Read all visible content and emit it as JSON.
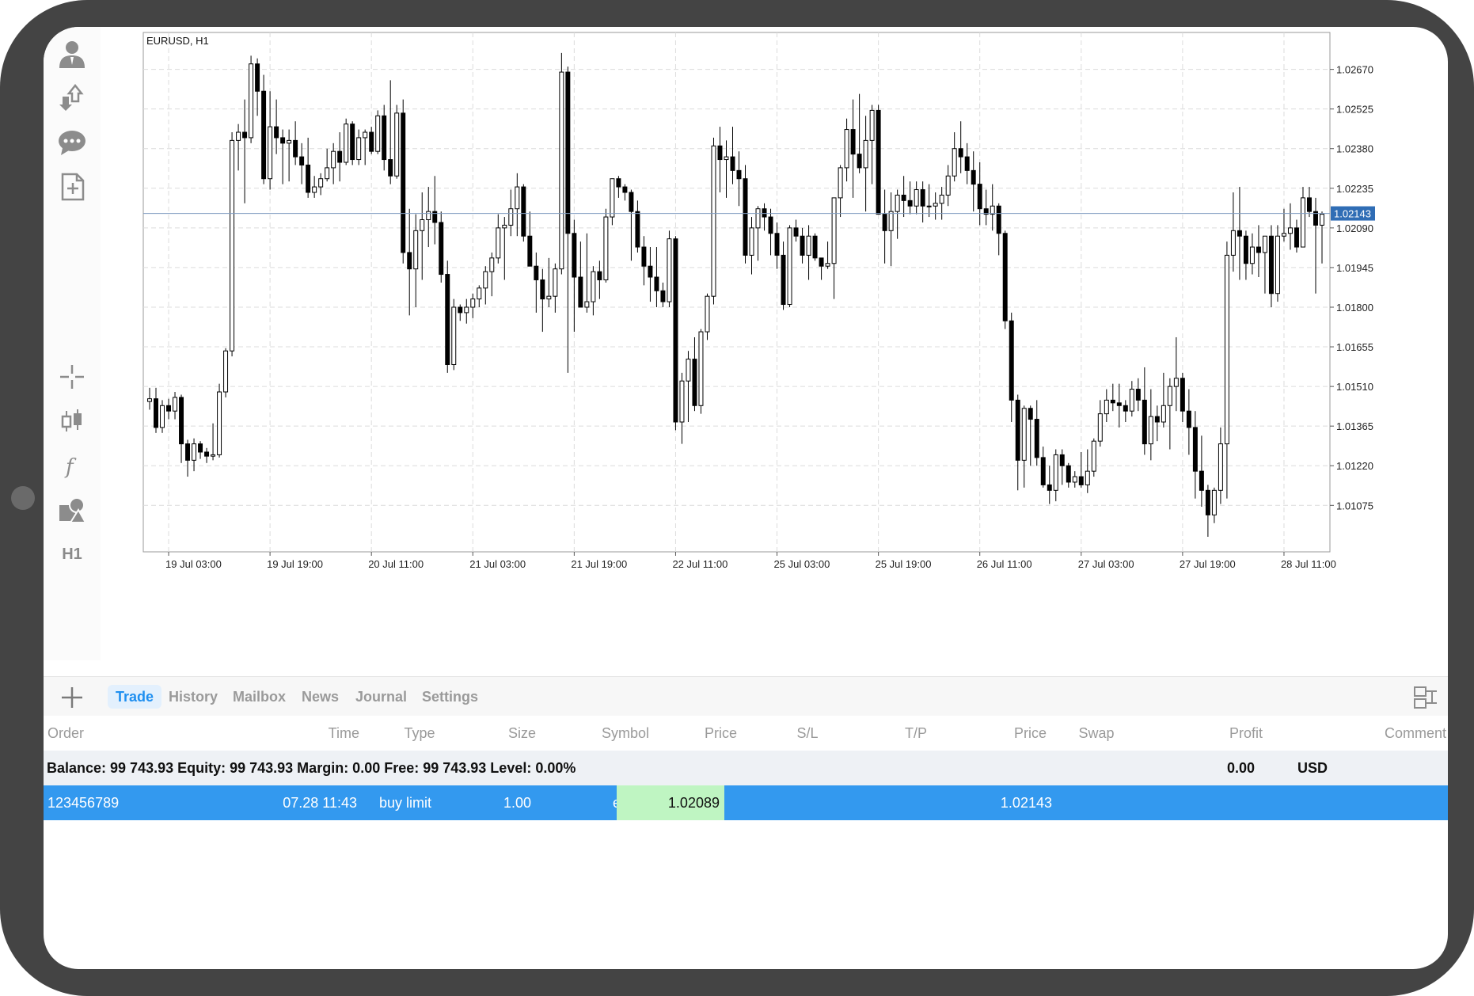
{
  "chart": {
    "symbol_label": "EURUSD, H1",
    "current_price_label": "1.02143"
  },
  "chart_data": {
    "type": "candlestick",
    "title": "EURUSD, H1",
    "timeframe": "H1",
    "ylim": [
      1.00905,
      1.02805
    ],
    "y_ticks": [
      "1.02670",
      "1.02525",
      "1.02380",
      "1.02235",
      "1.02090",
      "1.01945",
      "1.01800",
      "1.01655",
      "1.01510",
      "1.01365",
      "1.01220",
      "1.01075"
    ],
    "x_ticks": [
      "19 Jul 03:00",
      "19 Jul 19:00",
      "20 Jul 11:00",
      "21 Jul 03:00",
      "21 Jul 19:00",
      "22 Jul 11:00",
      "25 Jul 03:00",
      "25 Jul 19:00",
      "26 Jul 11:00",
      "27 Jul 03:00",
      "27 Jul 19:00",
      "28 Jul 11:00"
    ],
    "current_price": 1.02143,
    "grid": true,
    "colors": {
      "bull": "#ffffff",
      "bear": "#000000",
      "wick": "#000000",
      "grid": "#dcdcdc",
      "price_line": "#7f9cc0",
      "price_tag": "#2f6db5"
    },
    "candles": [
      [
        1.01455,
        1.01505,
        1.01425,
        1.01465
      ],
      [
        1.01465,
        1.01505,
        1.0134,
        1.0136
      ],
      [
        1.0136,
        1.0146,
        1.0134,
        1.0144
      ],
      [
        1.0144,
        1.01465,
        1.0139,
        1.0142
      ],
      [
        1.0142,
        1.0149,
        1.0139,
        1.0147
      ],
      [
        1.0147,
        1.0148,
        1.0123,
        1.013
      ],
      [
        1.013,
        1.01315,
        1.0118,
        1.0124
      ],
      [
        1.0124,
        1.0132,
        1.012,
        1.013
      ],
      [
        1.013,
        1.0131,
        1.01245,
        1.0127
      ],
      [
        1.0127,
        1.01285,
        1.0123,
        1.01255
      ],
      [
        1.01255,
        1.01375,
        1.0124,
        1.0126
      ],
      [
        1.0126,
        1.0152,
        1.0125,
        1.0149
      ],
      [
        1.0149,
        1.0165,
        1.0147,
        1.0164
      ],
      [
        1.0164,
        1.0244,
        1.0162,
        1.0241
      ],
      [
        1.0241,
        1.0247,
        1.023,
        1.0244
      ],
      [
        1.0244,
        1.0256,
        1.0218,
        1.0242
      ],
      [
        1.0242,
        1.0272,
        1.024,
        1.0269
      ],
      [
        1.0269,
        1.0271,
        1.025,
        1.0259
      ],
      [
        1.0259,
        1.0265,
        1.0225,
        1.0227
      ],
      [
        1.0227,
        1.0259,
        1.0223,
        1.0246
      ],
      [
        1.0246,
        1.0256,
        1.0236,
        1.0242
      ],
      [
        1.0242,
        1.0245,
        1.0225,
        1.024
      ],
      [
        1.024,
        1.0245,
        1.0226,
        1.0241
      ],
      [
        1.0241,
        1.0248,
        1.0232,
        1.0235
      ],
      [
        1.0235,
        1.024,
        1.0225,
        1.0232
      ],
      [
        1.0232,
        1.0242,
        1.022,
        1.0222
      ],
      [
        1.0222,
        1.0228,
        1.022,
        1.0224
      ],
      [
        1.0224,
        1.0229,
        1.0221,
        1.0227
      ],
      [
        1.0227,
        1.0238,
        1.0226,
        1.0231
      ],
      [
        1.0231,
        1.024,
        1.0225,
        1.0237
      ],
      [
        1.0237,
        1.0244,
        1.0226,
        1.0233
      ],
      [
        1.0233,
        1.0249,
        1.0232,
        1.0247
      ],
      [
        1.0247,
        1.0248,
        1.0232,
        1.0234
      ],
      [
        1.0234,
        1.0245,
        1.0232,
        1.0242
      ],
      [
        1.0242,
        1.0245,
        1.0232,
        1.0244
      ],
      [
        1.0244,
        1.0246,
        1.0236,
        1.0237
      ],
      [
        1.0237,
        1.0252,
        1.0236,
        1.025
      ],
      [
        1.025,
        1.0254,
        1.023,
        1.0234
      ],
      [
        1.0234,
        1.0263,
        1.0225,
        1.0228
      ],
      [
        1.0228,
        1.0254,
        1.0227,
        1.0251
      ],
      [
        1.0251,
        1.0256,
        1.0196,
        1.02
      ],
      [
        1.02,
        1.0216,
        1.0177,
        1.0194
      ],
      [
        1.0194,
        1.0214,
        1.018,
        1.0208
      ],
      [
        1.0208,
        1.0222,
        1.019,
        1.0212
      ],
      [
        1.0212,
        1.0224,
        1.0202,
        1.0215
      ],
      [
        1.0215,
        1.0228,
        1.0203,
        1.0211
      ],
      [
        1.0211,
        1.0215,
        1.0189,
        1.0192
      ],
      [
        1.0192,
        1.0197,
        1.0156,
        1.0159
      ],
      [
        1.0159,
        1.0183,
        1.0157,
        1.018
      ],
      [
        1.018,
        1.0181,
        1.0175,
        1.0178
      ],
      [
        1.0178,
        1.0183,
        1.0174,
        1.018
      ],
      [
        1.018,
        1.0185,
        1.0176,
        1.0183
      ],
      [
        1.0183,
        1.0188,
        1.018,
        1.0187
      ],
      [
        1.0187,
        1.0195,
        1.0181,
        1.0193
      ],
      [
        1.0193,
        1.02,
        1.0184,
        1.0198
      ],
      [
        1.0198,
        1.0214,
        1.0196,
        1.0209
      ],
      [
        1.0209,
        1.0213,
        1.019,
        1.021
      ],
      [
        1.021,
        1.0223,
        1.0206,
        1.0216
      ],
      [
        1.0216,
        1.0229,
        1.0206,
        1.0224
      ],
      [
        1.0224,
        1.0225,
        1.0204,
        1.0206
      ],
      [
        1.0206,
        1.0215,
        1.0196,
        1.0195
      ],
      [
        1.0195,
        1.02,
        1.0178,
        1.019
      ],
      [
        1.019,
        1.0194,
        1.0171,
        1.0183
      ],
      [
        1.0183,
        1.0198,
        1.018,
        1.0184
      ],
      [
        1.0184,
        1.0196,
        1.0178,
        1.0194
      ],
      [
        1.0194,
        1.0273,
        1.0192,
        1.0266
      ],
      [
        1.0266,
        1.0268,
        1.0156,
        1.0207
      ],
      [
        1.0207,
        1.0212,
        1.0171,
        1.0191
      ],
      [
        1.0191,
        1.0204,
        1.018,
        1.018
      ],
      [
        1.018,
        1.0207,
        1.0178,
        1.0182
      ],
      [
        1.0182,
        1.0195,
        1.0177,
        1.0193
      ],
      [
        1.0193,
        1.0197,
        1.0183,
        1.019
      ],
      [
        1.019,
        1.0216,
        1.0189,
        1.0213
      ],
      [
        1.0213,
        1.0226,
        1.021,
        1.0227
      ],
      [
        1.0227,
        1.0228,
        1.022,
        1.0224
      ],
      [
        1.0224,
        1.0225,
        1.0219,
        1.0222
      ],
      [
        1.0222,
        1.0223,
        1.0197,
        1.0215
      ],
      [
        1.0215,
        1.0219,
        1.02,
        1.0202
      ],
      [
        1.0202,
        1.0206,
        1.0188,
        1.0195
      ],
      [
        1.0195,
        1.0202,
        1.0182,
        1.0191
      ],
      [
        1.0191,
        1.0202,
        1.018,
        1.0186
      ],
      [
        1.0186,
        1.0189,
        1.018,
        1.0182
      ],
      [
        1.0182,
        1.0208,
        1.018,
        1.0205
      ],
      [
        1.0205,
        1.0206,
        1.0135,
        1.0138
      ],
      [
        1.0138,
        1.0156,
        1.013,
        1.0153
      ],
      [
        1.0153,
        1.0164,
        1.0138,
        1.0161
      ],
      [
        1.0161,
        1.0169,
        1.0142,
        1.0144
      ],
      [
        1.0144,
        1.0172,
        1.0141,
        1.0171
      ],
      [
        1.0171,
        1.0185,
        1.0168,
        1.0184
      ],
      [
        1.0184,
        1.0242,
        1.0181,
        1.0239
      ],
      [
        1.0239,
        1.0246,
        1.0222,
        1.0234
      ],
      [
        1.0234,
        1.0241,
        1.022,
        1.0235
      ],
      [
        1.0235,
        1.0246,
        1.0225,
        1.023
      ],
      [
        1.023,
        1.0237,
        1.0217,
        1.0227
      ],
      [
        1.0227,
        1.0232,
        1.0196,
        1.0199
      ],
      [
        1.0199,
        1.0213,
        1.0192,
        1.0209
      ],
      [
        1.0209,
        1.0217,
        1.0197,
        1.0216
      ],
      [
        1.0216,
        1.0218,
        1.0208,
        1.0213
      ],
      [
        1.0213,
        1.0216,
        1.0199,
        1.0207
      ],
      [
        1.0207,
        1.0211,
        1.0194,
        1.0199
      ],
      [
        1.0199,
        1.0204,
        1.0179,
        1.0181
      ],
      [
        1.0181,
        1.021,
        1.018,
        1.0209
      ],
      [
        1.0209,
        1.0212,
        1.0204,
        1.0206
      ],
      [
        1.0206,
        1.0209,
        1.0196,
        1.0199
      ],
      [
        1.0199,
        1.021,
        1.019,
        1.0206
      ],
      [
        1.0206,
        1.0207,
        1.0197,
        1.0198
      ],
      [
        1.0198,
        1.0196,
        1.019,
        1.0195
      ],
      [
        1.0195,
        1.0204,
        1.0194,
        1.0196
      ],
      [
        1.0196,
        1.0215,
        1.0183,
        1.022
      ],
      [
        1.022,
        1.0232,
        1.0213,
        1.0231
      ],
      [
        1.0231,
        1.0249,
        1.0226,
        1.0245
      ],
      [
        1.0245,
        1.0256,
        1.022,
        1.0236
      ],
      [
        1.0236,
        1.0258,
        1.0229,
        1.0231
      ],
      [
        1.0231,
        1.025,
        1.0215,
        1.0241
      ],
      [
        1.0241,
        1.0254,
        1.0225,
        1.0252
      ],
      [
        1.0252,
        1.0254,
        1.0215,
        1.0214
      ],
      [
        1.0214,
        1.0223,
        1.0196,
        1.0208
      ],
      [
        1.0208,
        1.0222,
        1.0195,
        1.0215
      ],
      [
        1.0215,
        1.0223,
        1.0205,
        1.0221
      ],
      [
        1.0221,
        1.0228,
        1.0213,
        1.0219
      ],
      [
        1.0219,
        1.0226,
        1.0214,
        1.0217
      ],
      [
        1.0217,
        1.0226,
        1.0214,
        1.0223
      ],
      [
        1.0223,
        1.0226,
        1.0211,
        1.0217
      ],
      [
        1.0217,
        1.0225,
        1.0213,
        1.0217
      ],
      [
        1.0217,
        1.0222,
        1.0212,
        1.0218
      ],
      [
        1.0218,
        1.0224,
        1.0212,
        1.0221
      ],
      [
        1.0221,
        1.0232,
        1.0217,
        1.0228
      ],
      [
        1.0228,
        1.0244,
        1.0226,
        1.0238
      ],
      [
        1.0238,
        1.0248,
        1.0229,
        1.0235
      ],
      [
        1.0235,
        1.024,
        1.0225,
        1.023
      ],
      [
        1.023,
        1.0237,
        1.0215,
        1.0225
      ],
      [
        1.0225,
        1.0233,
        1.021,
        1.0216
      ],
      [
        1.0216,
        1.0223,
        1.021,
        1.0214
      ],
      [
        1.0214,
        1.0225,
        1.0208,
        1.0217
      ],
      [
        1.0217,
        1.0218,
        1.0199,
        1.0207
      ],
      [
        1.0207,
        1.0208,
        1.0172,
        1.0175
      ],
      [
        1.0175,
        1.0178,
        1.0138,
        1.0146
      ],
      [
        1.0146,
        1.0148,
        1.0113,
        1.0124
      ],
      [
        1.0124,
        1.0144,
        1.0114,
        1.0143
      ],
      [
        1.0143,
        1.0144,
        1.0122,
        1.0139
      ],
      [
        1.0139,
        1.0146,
        1.0122,
        1.0125
      ],
      [
        1.0125,
        1.0129,
        1.0114,
        1.0115
      ],
      [
        1.0115,
        1.0122,
        1.0108,
        1.0113
      ],
      [
        1.0113,
        1.0128,
        1.0109,
        1.0126
      ],
      [
        1.0126,
        1.0128,
        1.0115,
        1.0122
      ],
      [
        1.0122,
        1.0123,
        1.0114,
        1.0116
      ],
      [
        1.0116,
        1.012,
        1.0114,
        1.0118
      ],
      [
        1.0118,
        1.0127,
        1.0114,
        1.0115
      ],
      [
        1.0115,
        1.0128,
        1.0112,
        1.012
      ],
      [
        1.012,
        1.0132,
        1.0118,
        1.0131
      ],
      [
        1.0131,
        1.0146,
        1.0129,
        1.0141
      ],
      [
        1.0141,
        1.015,
        1.0138,
        1.0146
      ],
      [
        1.0146,
        1.0152,
        1.0142,
        1.0145
      ],
      [
        1.0145,
        1.0152,
        1.0136,
        1.0144
      ],
      [
        1.0144,
        1.0146,
        1.0138,
        1.0142
      ],
      [
        1.0142,
        1.0153,
        1.014,
        1.015
      ],
      [
        1.015,
        1.0154,
        1.0142,
        1.0146
      ],
      [
        1.0146,
        1.0158,
        1.0126,
        1.013
      ],
      [
        1.013,
        1.015,
        1.0124,
        1.014
      ],
      [
        1.014,
        1.0144,
        1.0131,
        1.0138
      ],
      [
        1.0138,
        1.0156,
        1.0136,
        1.0144
      ],
      [
        1.0144,
        1.0154,
        1.0128,
        1.0151
      ],
      [
        1.0151,
        1.0169,
        1.0142,
        1.0154
      ],
      [
        1.0154,
        1.0156,
        1.0138,
        1.0142
      ],
      [
        1.0142,
        1.015,
        1.0126,
        1.0136
      ],
      [
        1.0136,
        1.0142,
        1.011,
        1.012
      ],
      [
        1.012,
        1.0133,
        1.0107,
        1.0113
      ],
      [
        1.0113,
        1.0115,
        1.0096,
        1.0104
      ],
      [
        1.0104,
        1.0114,
        1.0101,
        1.0113
      ],
      [
        1.0113,
        1.0136,
        1.0108,
        1.013
      ],
      [
        1.013,
        1.0204,
        1.011,
        1.0199
      ],
      [
        1.0199,
        1.0222,
        1.0193,
        1.0208
      ],
      [
        1.0208,
        1.0224,
        1.019,
        1.0206
      ],
      [
        1.0206,
        1.0208,
        1.019,
        1.0196
      ],
      [
        1.0196,
        1.0207,
        1.0192,
        1.0202
      ],
      [
        1.0202,
        1.021,
        1.0191,
        1.02
      ],
      [
        1.02,
        1.0203,
        1.0185,
        1.0206
      ],
      [
        1.0206,
        1.021,
        1.018,
        1.0185
      ],
      [
        1.0185,
        1.021,
        1.0182,
        1.0206
      ],
      [
        1.0206,
        1.0216,
        1.0204,
        1.0207
      ],
      [
        1.0207,
        1.0218,
        1.0201,
        1.0209
      ],
      [
        1.0209,
        1.0212,
        1.02,
        1.0202
      ],
      [
        1.0202,
        1.0224,
        1.0202,
        1.022
      ],
      [
        1.022,
        1.0224,
        1.0213,
        1.0215
      ],
      [
        1.0215,
        1.022,
        1.0185,
        1.021
      ],
      [
        1.021,
        1.0215,
        1.0196,
        1.0214
      ]
    ]
  },
  "toolbar": {
    "items": [
      "account-icon",
      "trade-transfer-icon",
      "chat-icon",
      "new-document-icon"
    ],
    "tools": [
      "crosshair-icon",
      "candlestick-icon",
      "indicator-icon",
      "objects-icon"
    ],
    "timeframe_label": "H1"
  },
  "tabs": [
    {
      "label": "Trade",
      "active": true
    },
    {
      "label": "History",
      "active": false
    },
    {
      "label": "Mailbox",
      "active": false
    },
    {
      "label": "News",
      "active": false
    },
    {
      "label": "Journal",
      "active": false
    },
    {
      "label": "Settings",
      "active": false
    }
  ],
  "table": {
    "headers": [
      "Order",
      "Time",
      "Type",
      "Size",
      "Symbol",
      "Price",
      "S/L",
      "T/P",
      "Price",
      "Swap",
      "Profit",
      "Comment"
    ],
    "balance": {
      "summary": "Balance: 99 743.93 Equity: 99 743.93 Margin: 0.00 Free: 99 743.93 Level: 0.00%",
      "profit": "0.00",
      "currency": "USD"
    },
    "order": {
      "order": "123456789",
      "time": "07.28 11:43",
      "type": "buy limit",
      "size": "1.00",
      "symbol": "eurusd",
      "price": "1.02089",
      "current_price": "1.02143"
    }
  }
}
